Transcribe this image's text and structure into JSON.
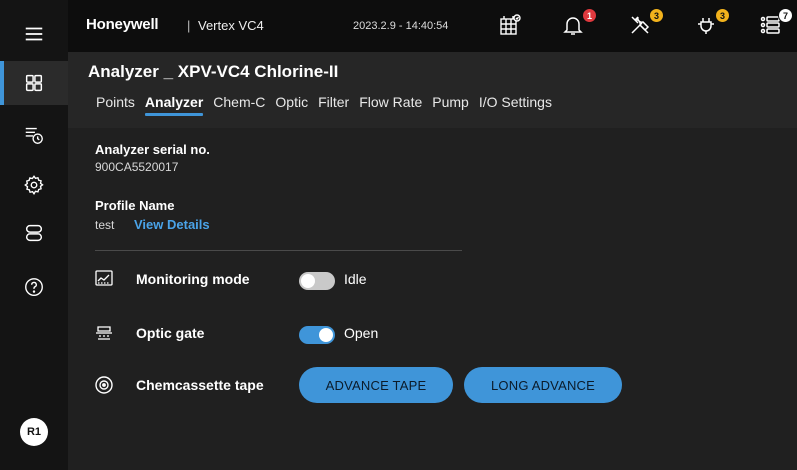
{
  "header": {
    "brand": "Honeywell",
    "separator": "|",
    "product": "Vertex VC4",
    "datetime": "2023.2.9 - 14:40:54",
    "icons": [
      {
        "name": "schedule-grid-icon",
        "badge": ""
      },
      {
        "name": "bell-icon",
        "badge": "1",
        "badge_color": "#e0393e"
      },
      {
        "name": "tools-icon",
        "badge": "3",
        "badge_color": "#f2b21c"
      },
      {
        "name": "maintenance-icon",
        "badge": "3",
        "badge_color": "#f2b21c"
      },
      {
        "name": "list-icon",
        "badge": "7",
        "badge_color": "#ffffff"
      }
    ]
  },
  "sidebar": {
    "items": [
      {
        "name": "menu-icon"
      },
      {
        "name": "dashboard-icon",
        "active": true
      },
      {
        "name": "event-list-icon"
      },
      {
        "name": "settings-icon"
      },
      {
        "name": "devices-icon"
      },
      {
        "name": "help-icon"
      }
    ],
    "avatar": "R1"
  },
  "main": {
    "title": "Analyzer _ XPV-VC4 Chlorine-II",
    "tabs": [
      "Points",
      "Analyzer",
      "Chem-C",
      "Optic",
      "Filter",
      "Flow Rate",
      "Pump",
      "I/O Settings"
    ],
    "active_tab": "Analyzer",
    "serial_label": "Analyzer serial no.",
    "serial_value": "900CA5520017",
    "profile_label": "Profile Name",
    "profile_value": "test",
    "profile_link": "View Details",
    "monitoring_label": "Monitoring mode",
    "monitoring_state": "Idle",
    "optic_label": "Optic gate",
    "optic_state": "Open",
    "tape_label": "Chemcassette tape",
    "advance_button": "ADVANCE TAPE",
    "long_advance_button": "LONG ADVANCE"
  },
  "colors": {
    "accent": "#3f95d9",
    "alert": "#e0393e",
    "warning": "#f2b21c"
  }
}
